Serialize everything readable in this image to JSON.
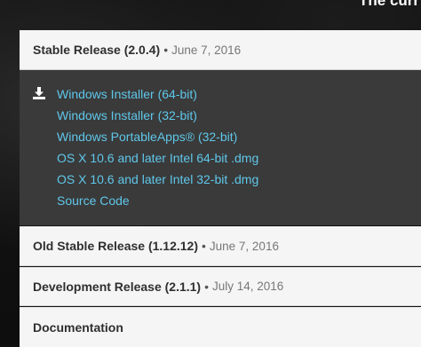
{
  "page": {
    "top_partial_text": "The curr"
  },
  "stable": {
    "title": "Stable Release (2.0.4)",
    "separator": "•",
    "date": "June 7, 2016",
    "download_icon": "download-icon",
    "links": [
      "Windows Installer (64-bit)",
      "Windows Installer (32-bit)",
      "Windows PortableApps® (32-bit)",
      "OS X 10.6 and later Intel 64-bit .dmg",
      "OS X 10.6 and later Intel 32-bit .dmg",
      "Source Code"
    ]
  },
  "old_stable": {
    "title": "Old Stable Release (1.12.12)",
    "separator": "•",
    "date": "June 7, 2016"
  },
  "development": {
    "title": "Development Release (2.1.1)",
    "separator": "•",
    "date": "July 14, 2016"
  },
  "documentation": {
    "title": "Documentation"
  },
  "colors": {
    "link": "#5fc7ea",
    "panel_body": "#3a3a3a",
    "panel_heading": "#f5f5f5",
    "page_background": "#101010"
  }
}
